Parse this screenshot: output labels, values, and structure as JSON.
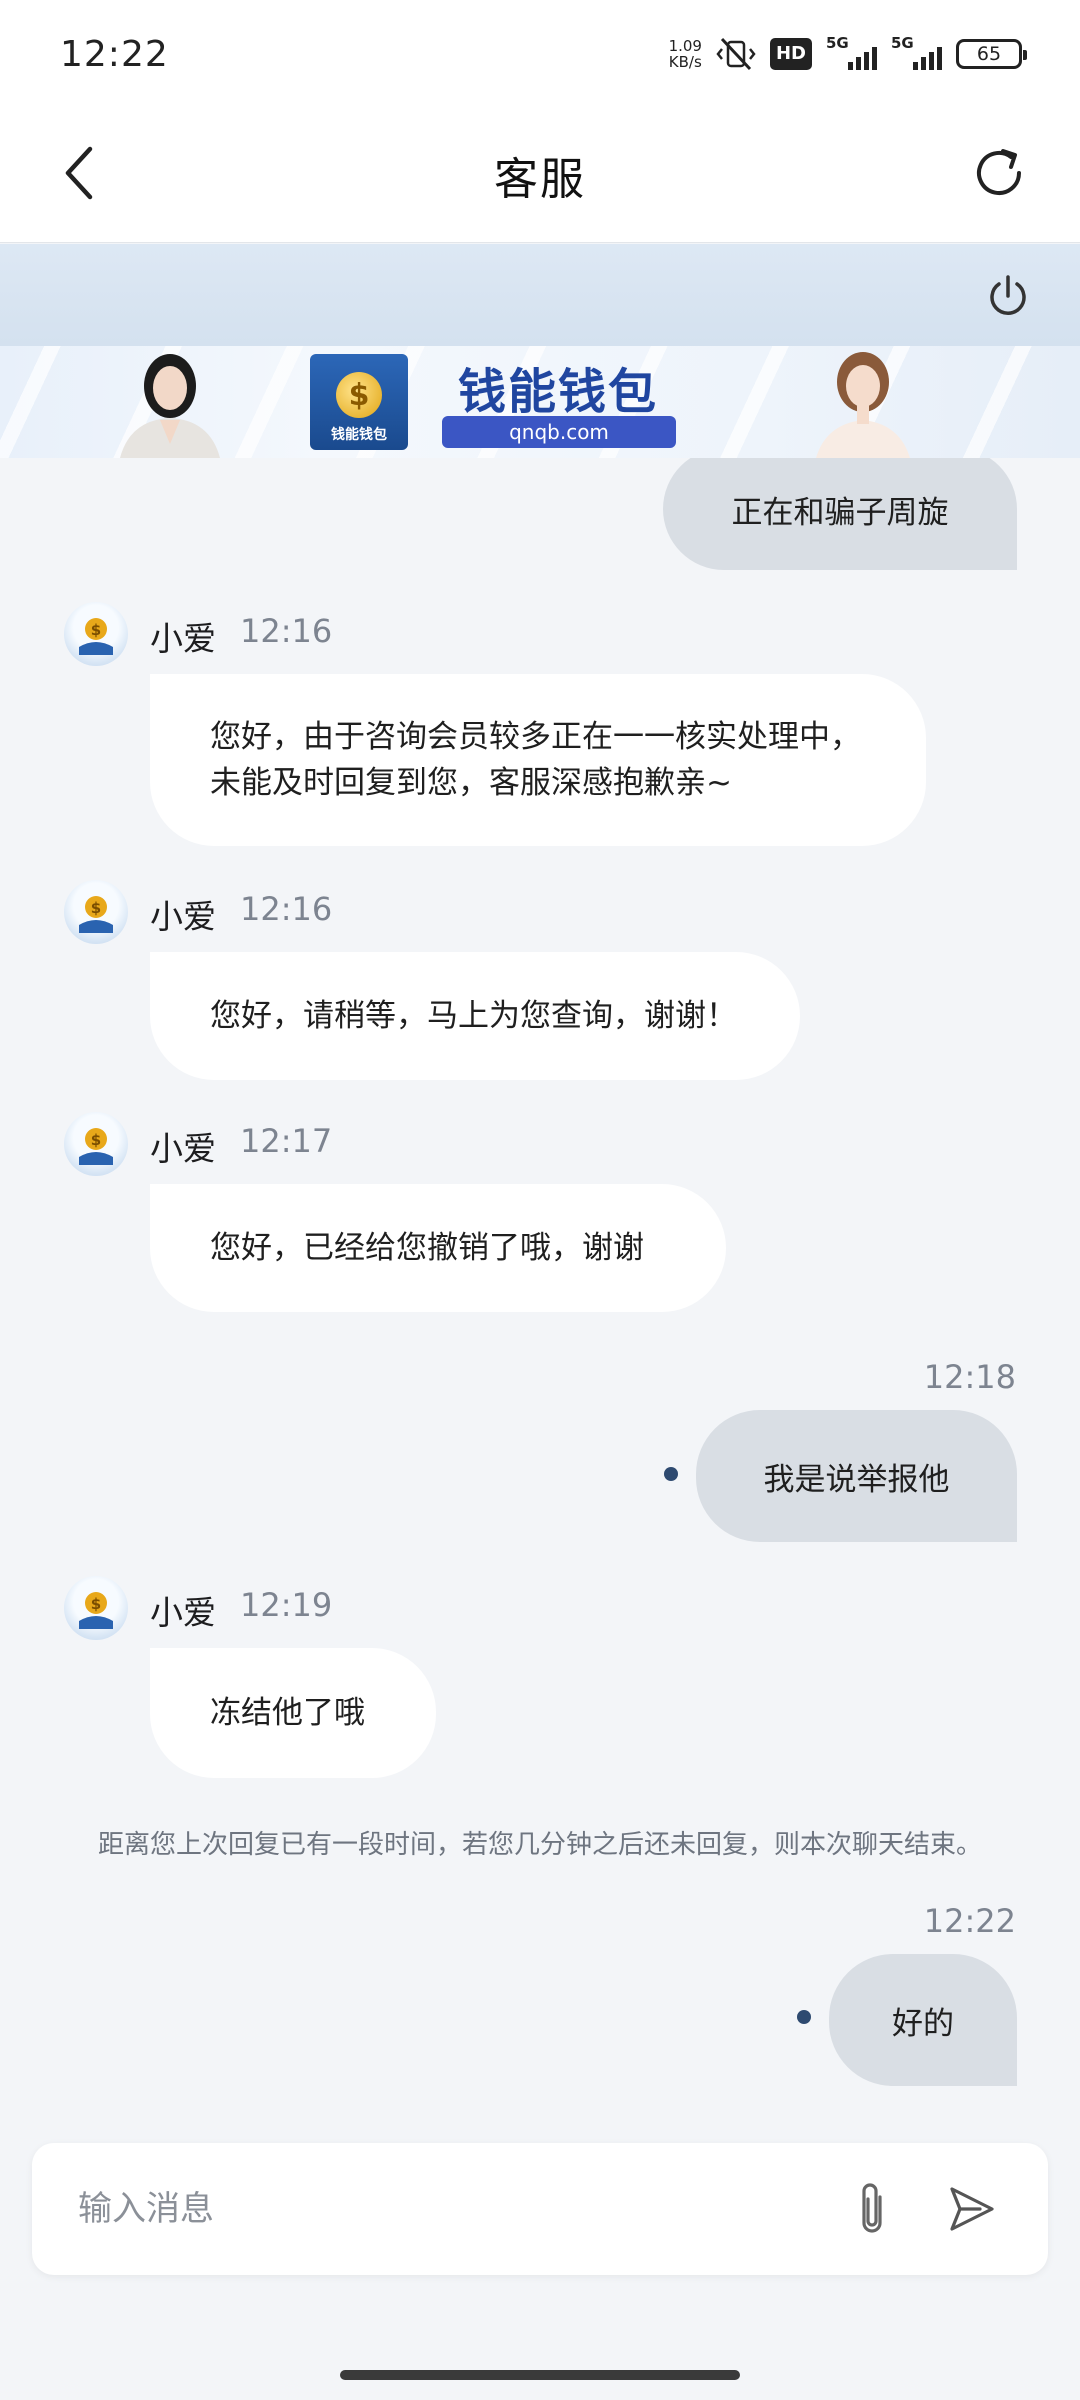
{
  "status_bar": {
    "time": "12:22",
    "net_speed_value": "1.09",
    "net_speed_unit": "KB/s",
    "hd_label": "HD",
    "sim1_label": "5G",
    "sim2_label": "5G",
    "battery": "65"
  },
  "header": {
    "title": "客服",
    "back_icon": "chevron-left-icon",
    "refresh_icon": "refresh-icon"
  },
  "top_band": {
    "power_icon": "power-icon"
  },
  "ad_banner": {
    "brand": "钱能钱包",
    "url": "qnqb.com",
    "logo_caption": "钱能钱包"
  },
  "messages": [
    {
      "direction": "out",
      "text": "正在和骗子周旋"
    },
    {
      "direction": "in",
      "sender": "小爱",
      "time": "12:16",
      "text": "您好，由于咨询会员较多正在一一核实处理中，未能及时回复到您，客服深感抱歉亲~"
    },
    {
      "direction": "in",
      "sender": "小爱",
      "time": "12:16",
      "text": "您好，请稍等，马上为您查询，谢谢！"
    },
    {
      "direction": "in",
      "sender": "小爱",
      "time": "12:17",
      "text": "您好，已经给您撤销了哦，谢谢"
    },
    {
      "direction": "out",
      "time": "12:18",
      "text": "我是说举报他"
    },
    {
      "direction": "in",
      "sender": "小爱",
      "time": "12:19",
      "text": "冻结他了哦"
    },
    {
      "direction": "out",
      "time": "12:22",
      "text": "好的"
    }
  ],
  "system_note": "距离您上次回复已有一段时间，若您几分钟之后还未回复，则本次聊天结束。",
  "input": {
    "placeholder": "输入消息",
    "value": "",
    "attach_icon": "paperclip-icon",
    "send_icon": "send-icon"
  },
  "colors": {
    "outgoing_bubble": "#d9dee4",
    "incoming_bubble": "#ffffff",
    "chat_background": "#f3f5f8",
    "unread_dot": "#2e4a70"
  }
}
